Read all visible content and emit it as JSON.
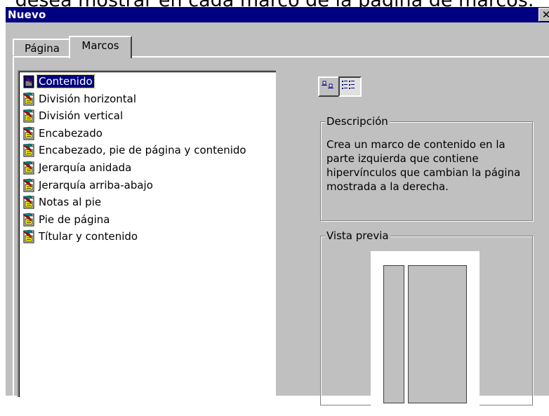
{
  "background_text": "desea mostrar en cada marco de la página de marcos.",
  "dialog": {
    "title": "Nuevo",
    "close_glyph": "✕"
  },
  "tabs": [
    {
      "label": "Página",
      "active": false
    },
    {
      "label": "Marcos",
      "active": true
    }
  ],
  "templates": {
    "selected_index": 0,
    "items": [
      {
        "label": "Contenido",
        "icon": "frame-template-icon"
      },
      {
        "label": "División horizontal",
        "icon": "frame-template-icon"
      },
      {
        "label": "División vertical",
        "icon": "frame-template-icon"
      },
      {
        "label": "Encabezado",
        "icon": "frame-template-icon"
      },
      {
        "label": "Encabezado, pie de página y contenido",
        "icon": "frame-template-icon"
      },
      {
        "label": "Jerarquía anidada",
        "icon": "frame-template-icon"
      },
      {
        "label": "Jerarquía arriba-abajo",
        "icon": "frame-template-icon"
      },
      {
        "label": "Notas al pie",
        "icon": "frame-template-icon"
      },
      {
        "label": "Pie de página",
        "icon": "frame-template-icon"
      },
      {
        "label": "Títular y contenido",
        "icon": "frame-template-icon"
      }
    ]
  },
  "view_buttons": [
    {
      "name": "large-icons-view-icon",
      "pressed": false
    },
    {
      "name": "list-view-icon",
      "pressed": true
    }
  ],
  "description": {
    "legend": "Descripción",
    "text": "Crea un marco de contenido en la parte izquierda que contiene hipervínculos que cambian la página mostrada a la derecha."
  },
  "preview": {
    "legend": "Vista previa"
  },
  "colors": {
    "title_bar": "#000080",
    "dialog_face": "#c0c0c0",
    "selection": "#000080"
  }
}
